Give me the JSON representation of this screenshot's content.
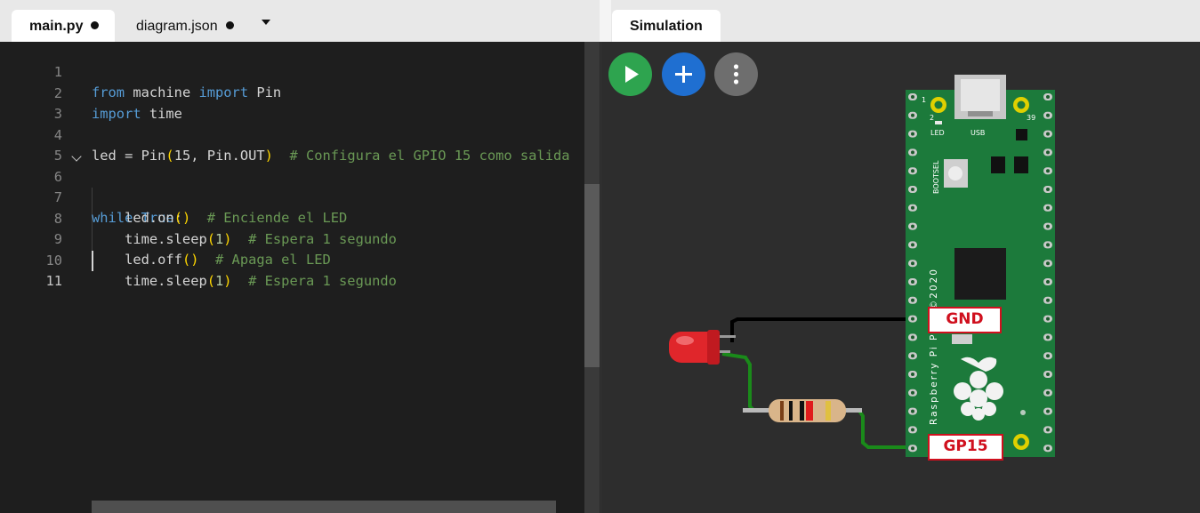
{
  "editor": {
    "tabs": [
      {
        "label": "main.py",
        "modified": true,
        "active": true
      },
      {
        "label": "diagram.json",
        "modified": true,
        "active": false
      }
    ],
    "lines": [
      {
        "n": "1"
      },
      {
        "n": "2"
      },
      {
        "n": "3"
      },
      {
        "n": "4"
      },
      {
        "n": "5"
      },
      {
        "n": "6"
      },
      {
        "n": "7"
      },
      {
        "n": "8"
      },
      {
        "n": "9"
      },
      {
        "n": "10"
      },
      {
        "n": "11"
      }
    ],
    "code": {
      "l1_from": "from",
      "l1_mid": " machine ",
      "l1_import": "import",
      "l1_end": " Pin",
      "l2_import": "import",
      "l2_end": " time",
      "l4_a": "led = Pin",
      "l4_op": "(",
      "l4_num": "15",
      "l4_b": ", Pin.OUT",
      "l4_cp": ")",
      "l4_comment": "  # Configura el GPIO 15 como salida",
      "l6_while": "while",
      "l6_true": " True",
      "l6_colon": ":",
      "l7_a": "    led.on",
      "l7_paren": "()",
      "l7_comment": "  # Enciende el LED",
      "l8_a": "    time.sleep",
      "l8_op": "(",
      "l8_num": "1",
      "l8_cp": ")",
      "l8_comment": "  # Espera 1 segundo",
      "l9_a": "    led.off",
      "l9_paren": "()",
      "l9_comment": "  # Apaga el LED",
      "l10_a": "    time.sleep",
      "l10_op": "(",
      "l10_num": "1",
      "l10_cp": ")",
      "l10_comment": "  # Espera 1 segundo"
    }
  },
  "simulation": {
    "tab_label": "Simulation",
    "buttons": [
      {
        "name": "play",
        "icon": "play-icon",
        "color": "#2ea44f"
      },
      {
        "name": "add",
        "icon": "plus-icon",
        "color": "#1f6fd1"
      },
      {
        "name": "more",
        "icon": "kebab-icon",
        "color": "#6e6e6e"
      }
    ],
    "board": {
      "silkscreen": "Raspberry Pi Pico ©2020",
      "pin1": "1",
      "pin2": "2",
      "pin39": "39",
      "led_label": "LED",
      "usb_label": "USB",
      "bootsel_label": "BOOTSEL"
    },
    "labels": {
      "gnd": "GND",
      "gp15": "GP15"
    },
    "colors": {
      "board": "#1c7a3b",
      "led": "#e0262b",
      "wire_gnd": "#000000",
      "wire_gp": "#1a8a1a",
      "label_border": "#d0101e"
    }
  }
}
